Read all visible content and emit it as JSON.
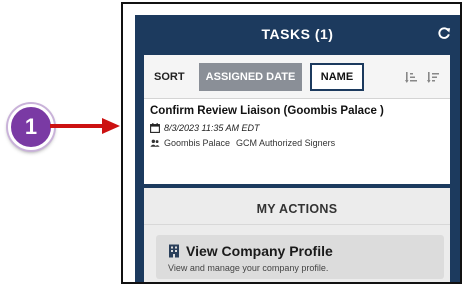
{
  "callout": {
    "number": "1"
  },
  "tasks": {
    "title": "TASKS (1)",
    "sort_label": "SORT",
    "sort_options": [
      "ASSIGNED DATE",
      "NAME"
    ],
    "selected_sort": "ASSIGNED DATE",
    "items": [
      {
        "title": "Confirm Review Liaison (Goombis Palace )",
        "date": "8/3/2023 11:35 AM EDT",
        "organization": "Goombis Palace",
        "group": "GCM Authorized Signers"
      }
    ]
  },
  "actions": {
    "title": "MY ACTIONS",
    "items": [
      {
        "title": "View Company Profile",
        "description": "View and manage your company profile."
      }
    ]
  },
  "colors": {
    "panel": "#1c3a5e",
    "callout": "#7a3aa4",
    "arrow": "#cc1111",
    "selected_sort_bg": "#8a8f97"
  },
  "icons": [
    "refresh-icon",
    "sort-ascending-icon",
    "sort-descending-icon",
    "calendar-icon",
    "people-icon",
    "building-icon"
  ]
}
